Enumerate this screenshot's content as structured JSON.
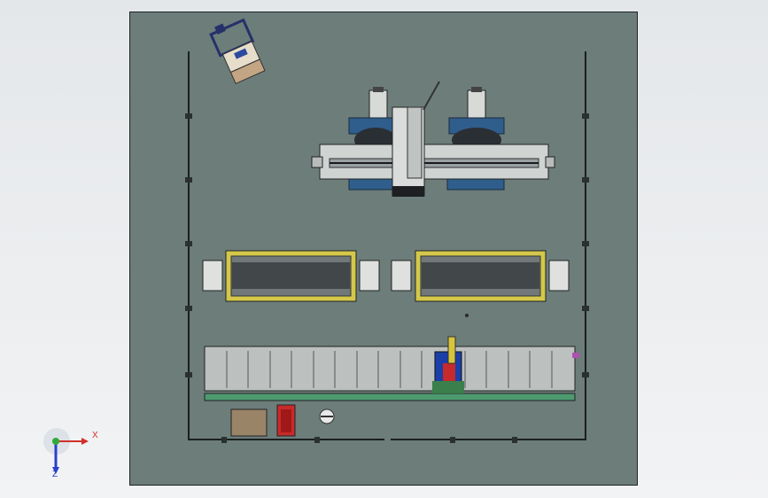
{
  "viewport": {
    "background_color": "#edeff0",
    "plate_color": "#6c7d7a"
  },
  "triad": {
    "x_label": "X",
    "z_label": "Z",
    "x_color": "#d0302a",
    "y_color": "#2faa3a",
    "z_color": "#2a3fcc"
  },
  "model": {
    "components": [
      {
        "name": "cart-unit",
        "icon": "cart-icon"
      },
      {
        "name": "robot-gantry",
        "icon": "gantry-icon"
      },
      {
        "name": "left-conveyor",
        "icon": "conveyor-icon"
      },
      {
        "name": "right-conveyor",
        "icon": "conveyor-icon"
      },
      {
        "name": "main-assembly-line",
        "icon": "assembly-line-icon"
      },
      {
        "name": "brown-crate",
        "icon": "crate-icon"
      },
      {
        "name": "red-cabinet",
        "icon": "cabinet-icon"
      },
      {
        "name": "round-device",
        "icon": "sensor-icon"
      }
    ]
  }
}
